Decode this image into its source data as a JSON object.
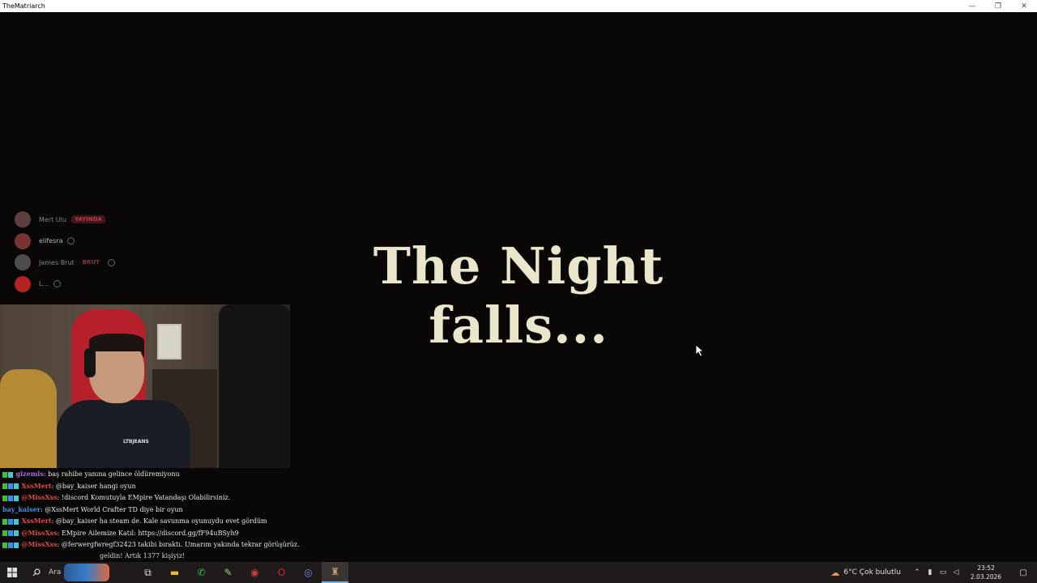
{
  "window": {
    "title": "TheMatriarch",
    "controls": {
      "minimize": "—",
      "maximize": "❐",
      "close": "✕"
    }
  },
  "game": {
    "message": "The Night falls..."
  },
  "voice_overlay": {
    "members": [
      {
        "name": "Mert Ulu",
        "tag": "YAYINDA",
        "avatar_color": "#6a4a4a"
      },
      {
        "name": "elifesra",
        "tag": "",
        "avatar_color": "#8a3a3a"
      },
      {
        "name": "James Brut",
        "tag": "BRUT",
        "avatar_color": "#5a5a5a"
      },
      {
        "name": "L...",
        "tag": "",
        "avatar_color": "#d02828"
      }
    ]
  },
  "webcam": {
    "shirt_text": "LTBJEANS"
  },
  "chat": {
    "messages": [
      {
        "user": "gizemls",
        "text": "baş rahibe yanına gelince öldüremiyonu",
        "color": "#a86ae0"
      },
      {
        "user": "XssMert",
        "text": "@bay_kaiser hangi oyun",
        "color": "#e04848"
      },
      {
        "user": "@MissXss",
        "text": "!discord Komutuyla EMpire Vatandaşı Olabilirsiniz.",
        "color": "#e04848"
      },
      {
        "user": "bay_kaiser",
        "text": "@XssMert World Crafter TD diye bir oyun",
        "color": "#4a8ee8"
      },
      {
        "user": "XssMert",
        "text": "@bay_kaiser ha steam de. Kale savunma oyunuydu evet gördüm",
        "color": "#e04848"
      },
      {
        "user": "@MissXss",
        "text": "EMpire Ailemize Katıl: https://discord.gg/fF94uBSyh9",
        "color": "#e04848"
      },
      {
        "user": "@MissXss",
        "text": "@ferwergfwregf32423 takibi bıraktı. Umarım yakında tekrar görüşürüz.",
        "color": "#e04848"
      }
    ],
    "overlay_banner": "geldin! Artık 1377 kişiyiz!"
  },
  "taskbar": {
    "start_icon": "windows-logo",
    "search_label": "Ara",
    "apps": [
      {
        "name": "task-view-icon",
        "glyph": "⧉",
        "color": "#e0e0e0"
      },
      {
        "name": "file-explorer-icon",
        "glyph": "▬",
        "color": "#e8b838"
      },
      {
        "name": "whatsapp-icon",
        "glyph": "✆",
        "color": "#30c050"
      },
      {
        "name": "app-icon",
        "glyph": "✎",
        "color": "#9ad070"
      },
      {
        "name": "chrome-icon",
        "glyph": "◉",
        "color": "#d04040"
      },
      {
        "name": "opera-icon",
        "glyph": "O",
        "color": "#e02030"
      },
      {
        "name": "discord-icon",
        "glyph": "◎",
        "color": "#7080f0"
      },
      {
        "name": "game-icon",
        "glyph": "♜",
        "color": "#c0a070"
      }
    ],
    "weather": {
      "temp": "6°C",
      "condition": "Çok bulutlu"
    },
    "clock": {
      "time": "23:52",
      "date": "2.03.2026"
    }
  }
}
